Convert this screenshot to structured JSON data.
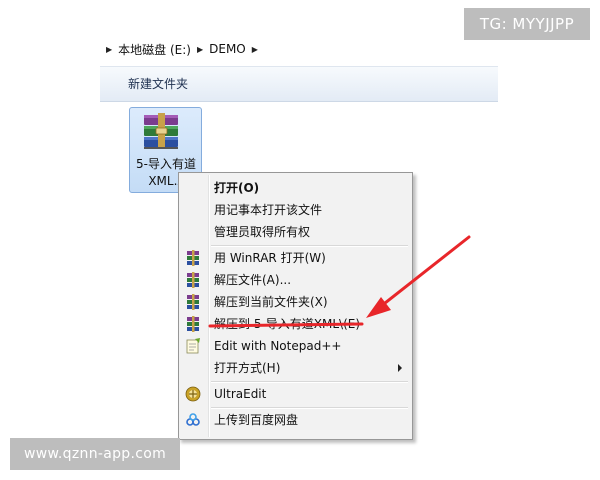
{
  "watermarks": {
    "top_right": "TG: MYYJJPP",
    "bottom_left": "www.qznn-app.com"
  },
  "explorer": {
    "breadcrumb": [
      "本地磁盘 (E:)",
      "DEMO"
    ],
    "toolbar": {
      "new_folder_label": "新建文件夹"
    },
    "file": {
      "name_line1": "5-导入有道",
      "name_line2": "XML.z",
      "icon": "winrar-archive-icon"
    }
  },
  "context_menu": {
    "items": [
      {
        "label": "打开(O)",
        "icon": "",
        "bold": true,
        "submenu": false
      },
      {
        "label": "用记事本打开该文件",
        "icon": "",
        "bold": false,
        "submenu": false
      },
      {
        "label": "管理员取得所有权",
        "icon": "",
        "bold": false,
        "submenu": false
      },
      {
        "label": "用 WinRAR 打开(W)",
        "icon": "winrar-icon",
        "bold": false,
        "submenu": false
      },
      {
        "label": "解压文件(A)...",
        "icon": "winrar-icon",
        "bold": false,
        "submenu": false
      },
      {
        "label": "解压到当前文件夹(X)",
        "icon": "winrar-icon",
        "bold": false,
        "submenu": false
      },
      {
        "label": "解压到 5-导入有道XML\\(E)",
        "icon": "winrar-icon",
        "bold": false,
        "submenu": false,
        "highlighted_annotation": true
      },
      {
        "label": "Edit with Notepad++",
        "icon": "notepad-plus-icon",
        "bold": false,
        "submenu": false
      },
      {
        "label": "打开方式(H)",
        "icon": "",
        "bold": false,
        "submenu": true
      },
      {
        "label": "UltraEdit",
        "icon": "ultraedit-icon",
        "bold": false,
        "submenu": false
      },
      {
        "label": "上传到百度网盘",
        "icon": "baidu-netdisk-icon",
        "bold": false,
        "submenu": false
      }
    ]
  },
  "annotation": {
    "color": "#e8262a"
  }
}
